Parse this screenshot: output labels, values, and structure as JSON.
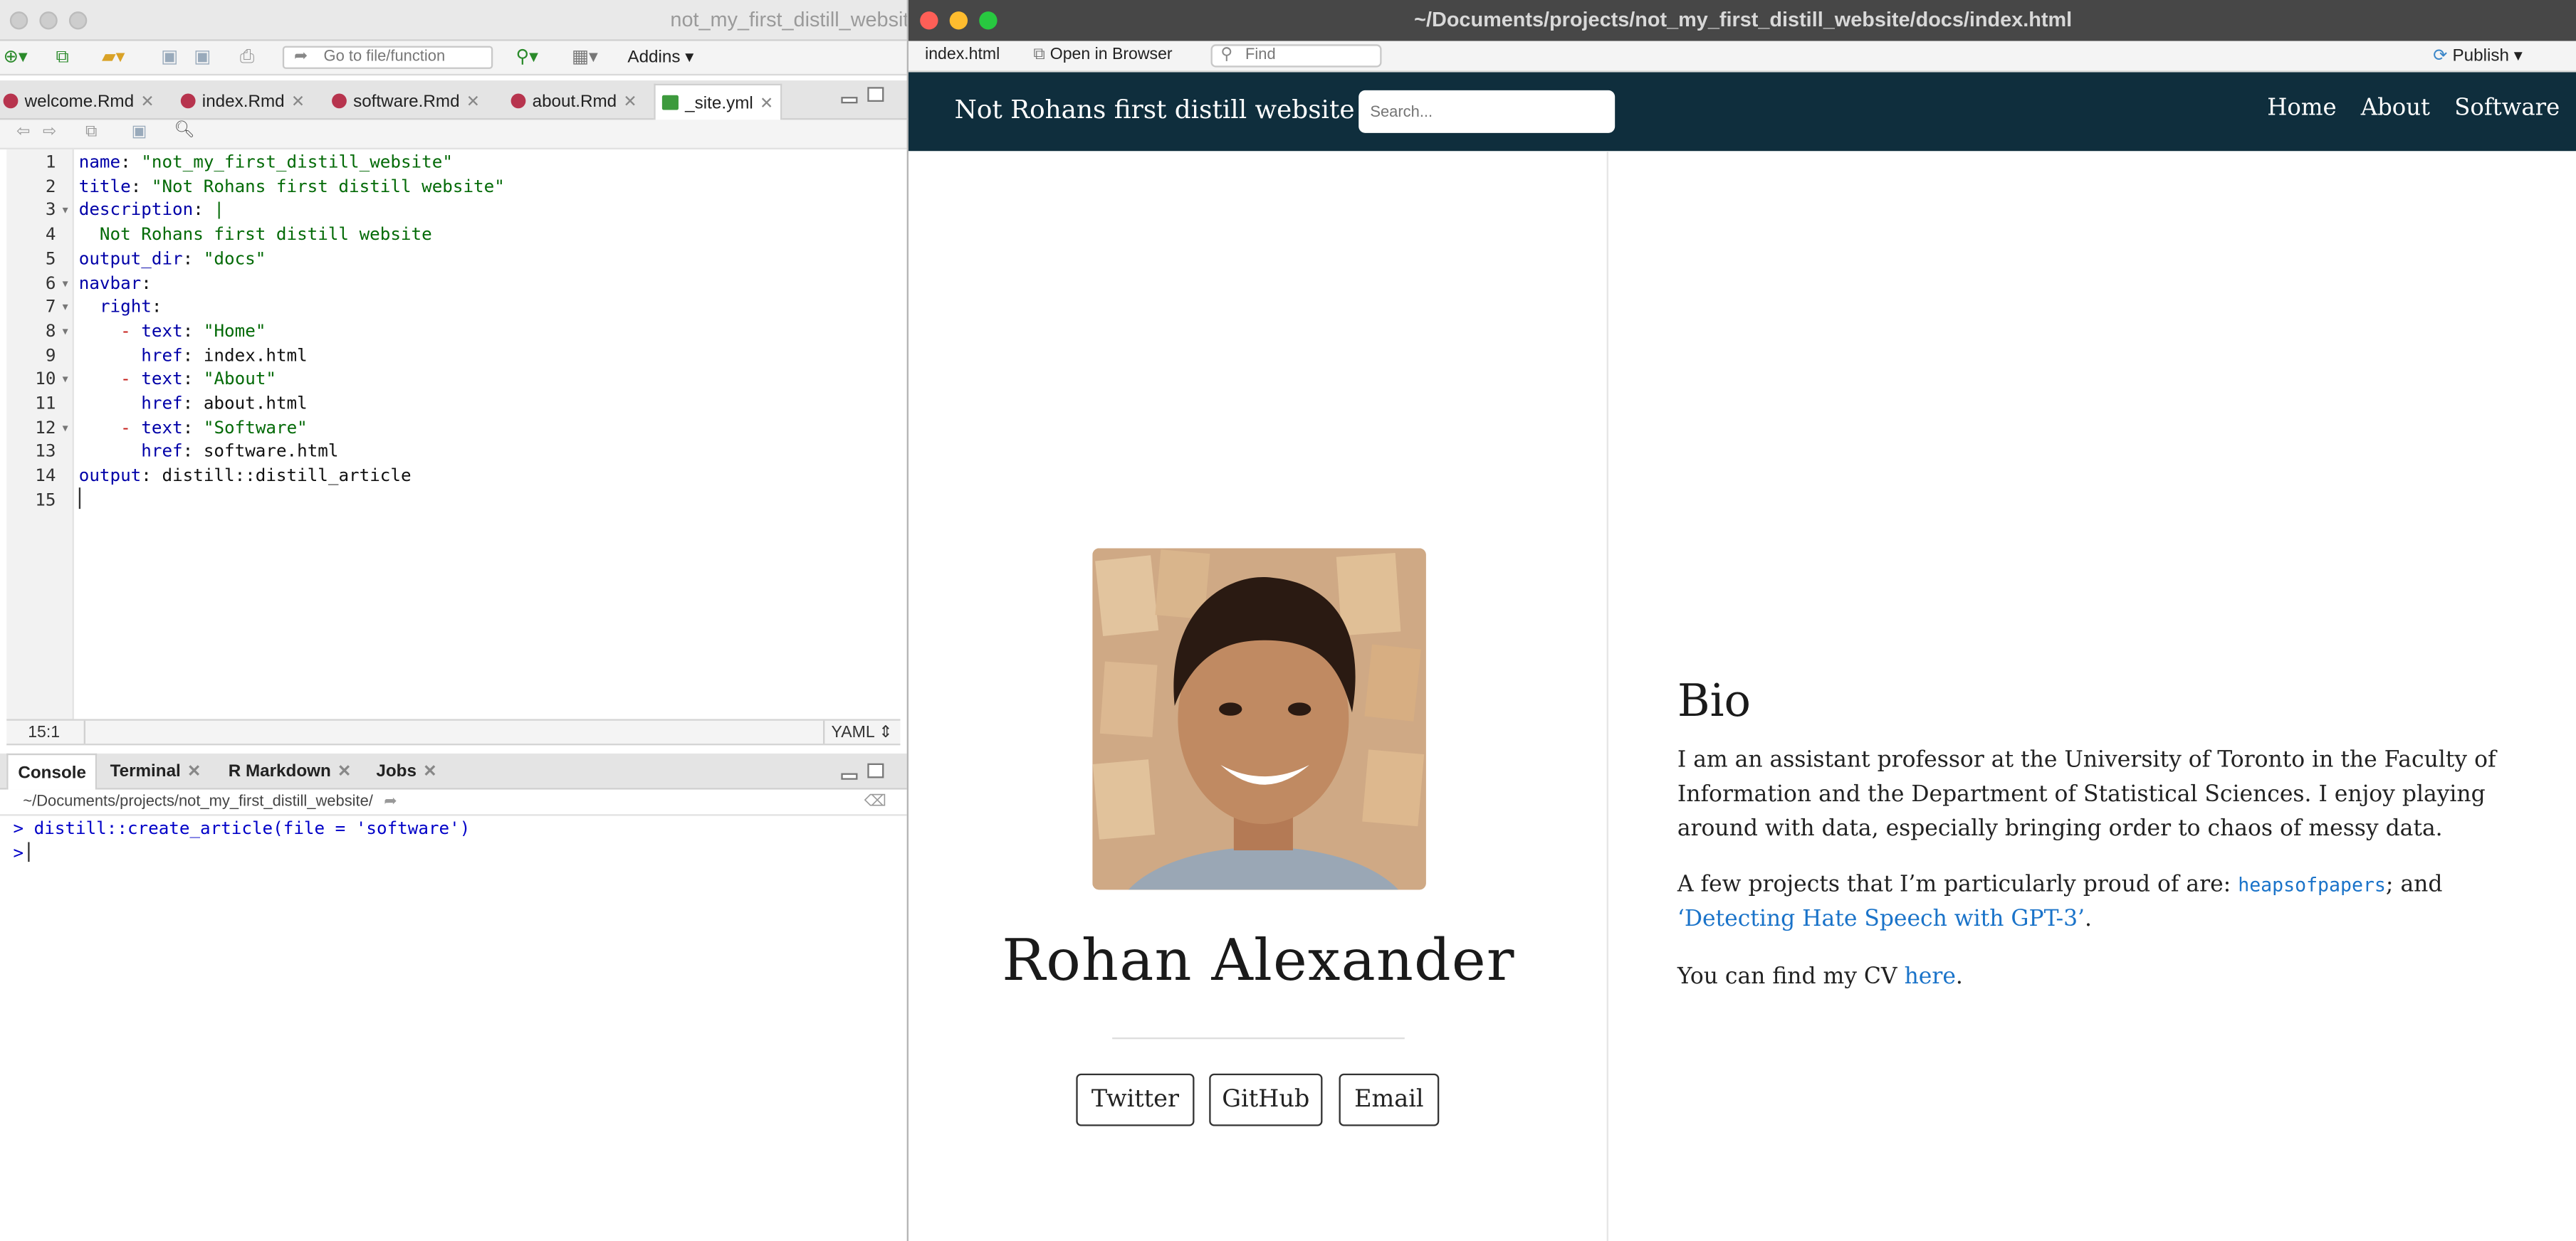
{
  "rstudio": {
    "window_title": "not_my_first_distill_website",
    "toolbar": {
      "goto_placeholder": "Go to file/function",
      "addins_label": "Addins"
    },
    "editor_tabs": [
      {
        "label": "welcome.Rmd",
        "type": "rmd"
      },
      {
        "label": "index.Rmd",
        "type": "rmd"
      },
      {
        "label": "software.Rmd",
        "type": "rmd"
      },
      {
        "label": "about.Rmd",
        "type": "rmd"
      },
      {
        "label": "_site.yml",
        "type": "yml",
        "active": true
      }
    ],
    "code_lines": [
      "name: \"not_my_first_distill_website\"",
      "title: \"Not Rohans first distill website\"",
      "description: |",
      "  Not Rohans first distill website",
      "output_dir: \"docs\"",
      "navbar:",
      "  right:",
      "    - text: \"Home\"",
      "      href: index.html",
      "    - text: \"About\"",
      "      href: about.html",
      "    - text: \"Software\"",
      "      href: software.html",
      "output: distill::distill_article",
      ""
    ],
    "line_numbers": [
      "1",
      "2",
      "3",
      "4",
      "5",
      "6",
      "7",
      "8",
      "9",
      "10",
      "11",
      "12",
      "13",
      "14",
      "15"
    ],
    "status": {
      "position": "15:1",
      "language": "YAML"
    },
    "console_tabs": [
      "Console",
      "Terminal",
      "R Markdown",
      "Jobs"
    ],
    "console_path": "~/Documents/projects/not_my_first_distill_website/",
    "console_lines": [
      {
        "prompt": ">",
        "text": "distill::create_article(file = 'software')"
      },
      {
        "prompt": ">",
        "text": ""
      }
    ]
  },
  "viewer": {
    "window_title": "~/Documents/projects/not_my_first_distill_website/docs/index.html",
    "toolbar": {
      "file_label": "index.html",
      "open_label": "Open in Browser",
      "find_placeholder": "Find",
      "publish_label": "Publish"
    },
    "site": {
      "title": "Not Rohans first distill website",
      "search_placeholder": "Search...",
      "nav_links": [
        "Home",
        "About",
        "Software"
      ],
      "author_name": "Rohan Alexander",
      "buttons": [
        "Twitter",
        "GitHub",
        "Email"
      ],
      "bio_heading": "Bio",
      "bio_p1": "I am an assistant professor at the University of Toronto in the Faculty of Information and the Department of Statistical Sciences. I enjoy playing around with data, especially bringing order to chaos of messy data.",
      "bio_p2_prefix": "A few projects that I’m particularly proud of are: ",
      "bio_p2_link1": "heapsofpapers",
      "bio_p2_mid": "; and ",
      "bio_p2_link2": "‘Detecting Hate Speech with GPT-3’",
      "bio_p2_suffix": ".",
      "bio_p3_prefix": "You can find my CV ",
      "bio_p3_link": "here",
      "bio_p3_suffix": "."
    },
    "colors": {
      "navbar": "#0f2e3d",
      "link": "#1a73c9"
    }
  }
}
